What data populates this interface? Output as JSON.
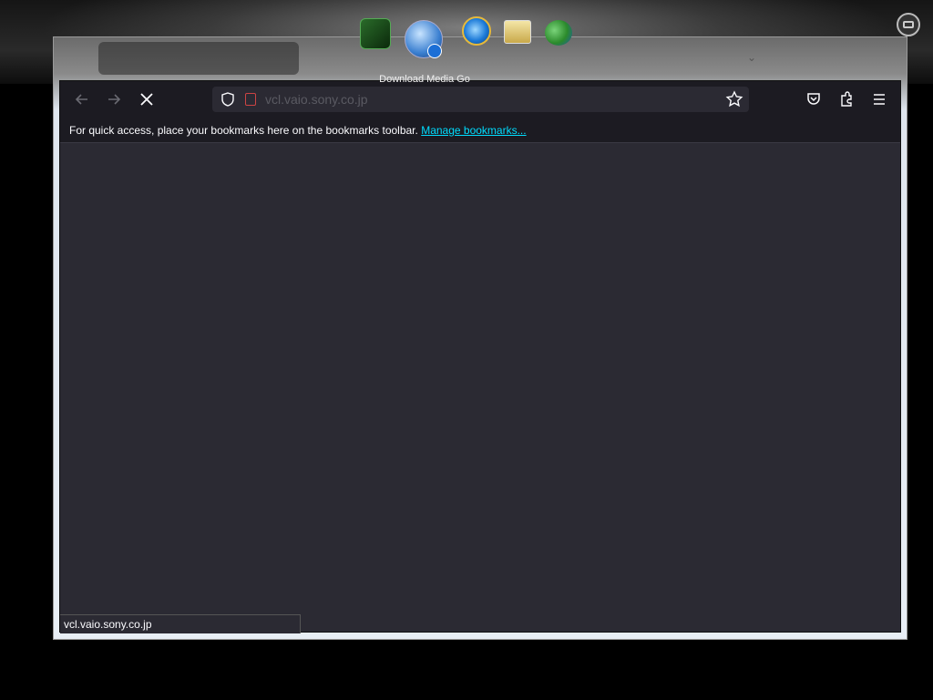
{
  "browser": {
    "url": "vcl.vaio.sony.co.jp",
    "status_text": "vcl.vaio.sony.co.jp",
    "bookmarks_hint": "For quick access, place your bookmarks here on the bookmarks toolbar.",
    "manage_bookmarks_label": "Manage bookmarks..."
  },
  "dock": {
    "hover_label": "Download Media Go",
    "icons": [
      "media-app-icon",
      "download-media-go-icon",
      "internet-explorer-icon",
      "photo-app-icon",
      "messenger-icon"
    ]
  },
  "colors": {
    "toolbar_bg": "#1c1b22",
    "content_bg": "#2b2a33",
    "link": "#00ddff"
  }
}
